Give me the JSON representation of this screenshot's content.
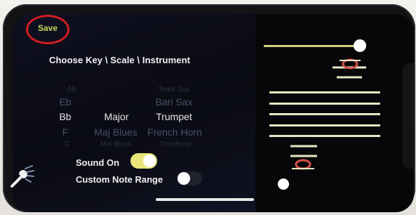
{
  "toolbar": {
    "save_label": "Save"
  },
  "heading": "Choose Key \\ Scale \\ Instrument",
  "keys": {
    "above_above": "Ab",
    "above": "Eb",
    "selected": "Bb",
    "below": "F",
    "below_below": "C"
  },
  "scales": {
    "selected": "Major",
    "below": "Maj Blues",
    "below_below": "Min Blues"
  },
  "instruments": {
    "above_above": "Tenor Sax",
    "above": "Bari Sax",
    "selected": "Trumpet",
    "below": "French Horn",
    "below_below": "Trombone"
  },
  "settings": {
    "sound_on_label": "Sound On",
    "sound_on_state": true,
    "custom_range_label": "Custom Note Range",
    "custom_range_state": false
  },
  "range_slider_level": 1.0,
  "icons": {
    "settings": "tools-icon"
  },
  "colors": {
    "save_circle": "#d31d24",
    "toggle_on": "#e9e67a",
    "note_red": "#d9504b",
    "staff": "#e8e7c5"
  }
}
